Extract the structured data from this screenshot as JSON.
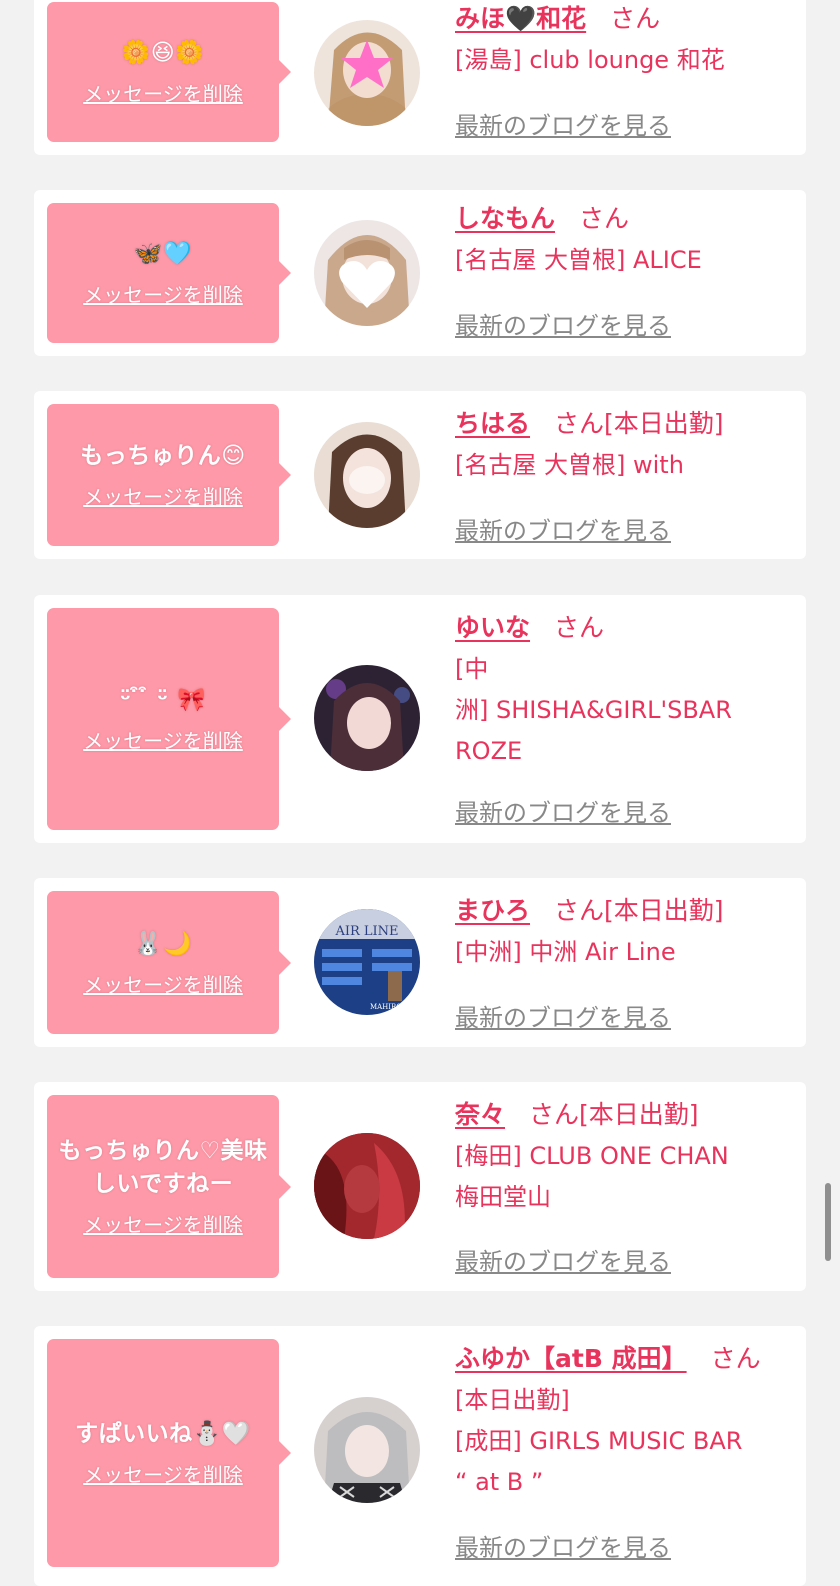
{
  "colors": {
    "accent": "#e8345c",
    "bubble": "#fd99a8",
    "link_gray": "#888888",
    "background": "#f2f2f2"
  },
  "delete_label": "メッセージを削除",
  "blog_label": "最新のブログを見る",
  "honorific": "さん",
  "today_label": "[本日出勤]",
  "items": [
    {
      "message": "🌼😆🌼",
      "name": "みほ🖤和花",
      "today": "",
      "shop": "[湯島] club lounge 和花",
      "avatar": "photo-avatar-star-sticker"
    },
    {
      "message": "🦋🩵",
      "name": "しなもん",
      "today": "",
      "shop": "[名古屋 大曽根] ALICE",
      "avatar": "photo-avatar-heart-sticker"
    },
    {
      "message": "もっちゅりん😊",
      "name": "ちはる",
      "today": "[本日出勤]",
      "shop": "[名古屋 大曽根] with",
      "avatar": "photo-avatar-blur"
    },
    {
      "message": "ᵕ̈ ͒ ͒ ᵕ̈ 🎀",
      "name": "ゆいな",
      "today": "",
      "shop": "[中\n洲] SHISHA&GIRL'SBAR\nROZE",
      "avatar": "photo-avatar-dark"
    },
    {
      "message": "🐰🌙",
      "name": "まひろ",
      "today": "[本日出勤]",
      "shop": "[中洲] 中洲 Air Line",
      "avatar": "photo-avatar-airline-card",
      "avatar_text": "AIR LINE",
      "avatar_subtext": "MAHIRO"
    },
    {
      "message": "もっちゅりん♡美味しいですねー",
      "name": "奈々",
      "today": "[本日出勤]",
      "shop": "[梅田] CLUB ONE CHAN\n梅田堂山",
      "avatar": "photo-avatar-red"
    },
    {
      "message": "すぱいいね⛄️🤍",
      "name": "ふゆか【atB 成田】",
      "today": "",
      "shop": "[本日出勤]\n[成田] GIRLS MUSIC BAR\n“ at B ”",
      "avatar": "photo-avatar-silver-hair"
    }
  ]
}
